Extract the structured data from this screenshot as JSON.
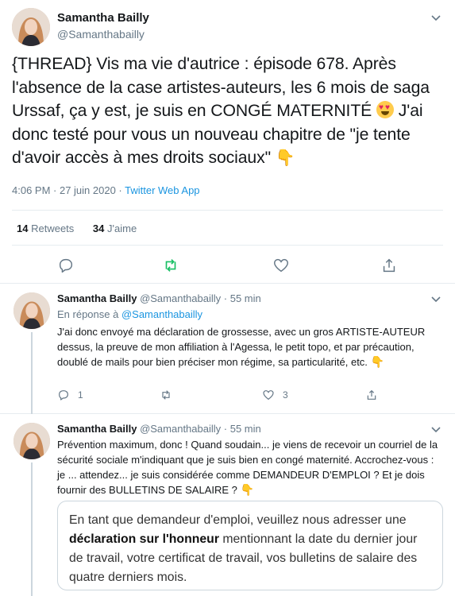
{
  "main_tweet": {
    "author_name": "Samantha Bailly",
    "author_handle": "@Samanthabailly",
    "text_part1": "{THREAD} Vis ma vie d'autrice : épisode 678. Après l'absence de la case artistes-auteurs, les 6 mois de saga Urssaf, ça y est, je suis en CONGÉ MATERNITÉ ",
    "text_part2": " J'ai donc testé pour vous un nouveau chapitre de \"je tente d'avoir accès à mes droits sociaux\" ",
    "timestamp": "4:06 PM · 27 juin 2020 · ",
    "source": "Twitter Web App",
    "retweets_count": "14",
    "retweets_label": "Retweets",
    "likes_count": "34",
    "likes_label": "J'aime"
  },
  "replies": [
    {
      "author_name": "Samantha Bailly",
      "author_handle": "@Samanthabailly",
      "time": "· 55 min",
      "in_reply_label": "En réponse à ",
      "in_reply_handle": "@Samanthabailly",
      "text": "J'ai donc envoyé ma déclaration de grossesse, avec un gros ARTISTE-AUTEUR dessus, la preuve de mon affiliation à l'Agessa, le petit topo, et par précaution, doublé de mails pour bien préciser mon régime, sa particularité, etc. ",
      "reply_count": "1",
      "like_count": "3"
    },
    {
      "author_name": "Samantha Bailly",
      "author_handle": "@Samanthabailly",
      "time": "· 55 min",
      "text": "Prévention maximum, donc ! Quand soudain... je viens de recevoir un courriel de la sécurité sociale m'indiquant que je suis bien en congé maternité. Accrochez-vous : je ... attendez... je suis considérée comme DEMANDEUR D'EMPLOI ? Et je dois fournir des BULLETINS DE SALAIRE ? ",
      "quote_part1": "En tant que demandeur d'emploi, veuillez nous adresser une ",
      "quote_bold": "déclaration sur l'honneur",
      "quote_part2": " mentionnant la date du dernier jour de travail, votre certificat de travail, vos bulletins de salaire des quatre derniers mois."
    }
  ],
  "icons": {
    "caret": "chevron-down-icon",
    "reply": "reply-icon",
    "retweet": "retweet-icon",
    "like": "heart-icon",
    "share": "share-icon",
    "emoji_heart_eyes": "heart-eyes-emoji-icon",
    "emoji_pointing_down": "pointing-down-emoji-icon"
  },
  "colors": {
    "link_blue": "#1b95e0",
    "retweet_green": "#17bf63",
    "muted_gray": "#657786",
    "border": "#e6ecf0"
  }
}
